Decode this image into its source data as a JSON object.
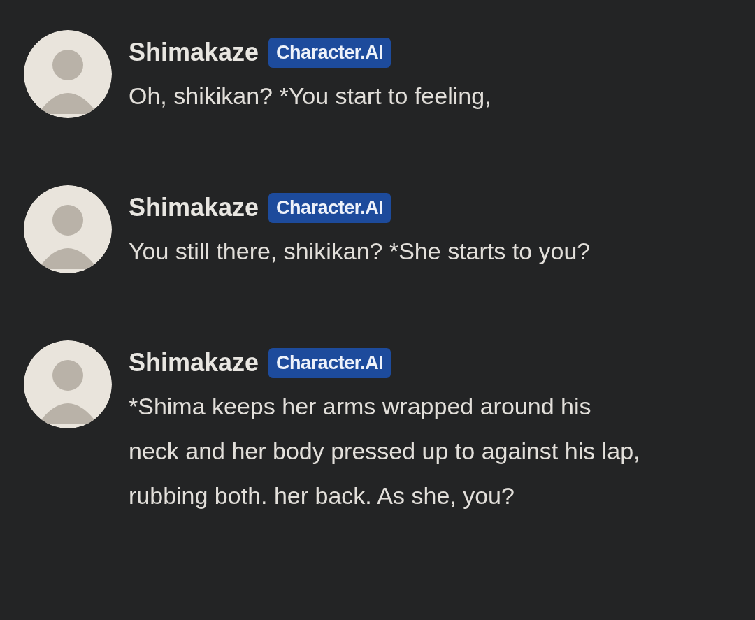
{
  "messages": [
    {
      "name": "Shimakaze",
      "badge": "Character.AI",
      "text": "Oh, shikikan? *You start to feeling,"
    },
    {
      "name": "Shimakaze",
      "badge": "Character.AI",
      "text": "You still there, shikikan? *She starts to you?"
    },
    {
      "name": "Shimakaze",
      "badge": "Character.AI",
      "text": "*Shima keeps her arms wrapped around his neck and her body pressed up to against his lap, rubbing both. her back. As she, you?"
    }
  ]
}
